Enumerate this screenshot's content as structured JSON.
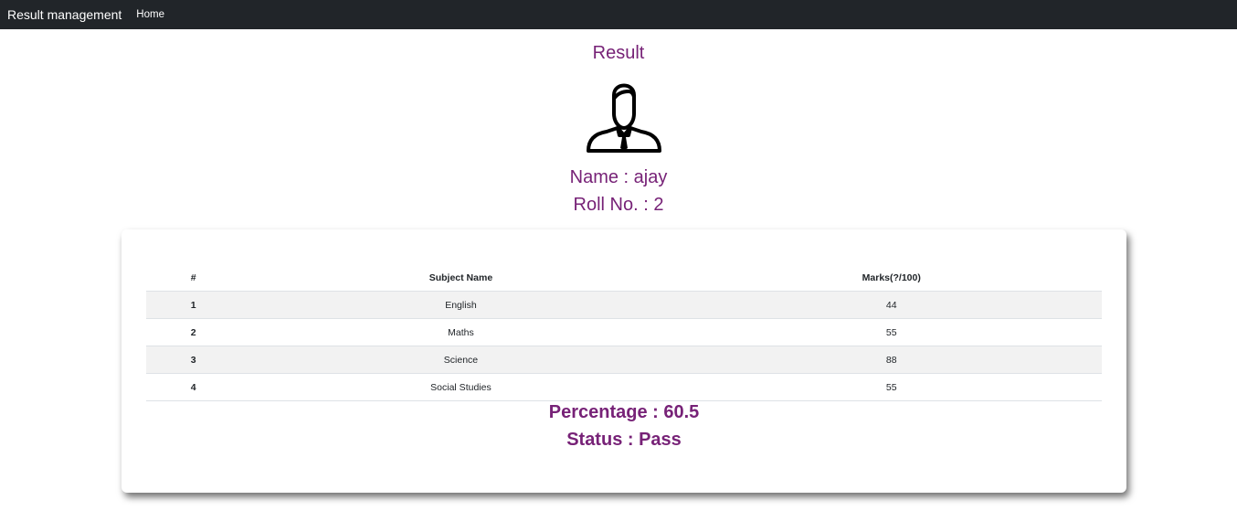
{
  "navbar": {
    "brand": "Result management",
    "links": [
      "Home"
    ]
  },
  "page": {
    "title": "Result",
    "avatar_icon": "user-avatar-icon",
    "name_line": "Name : ajay",
    "roll_line": "Roll No. : 2"
  },
  "table": {
    "headers": [
      "#",
      "Subject Name",
      "Marks(?/100)"
    ],
    "rows": [
      [
        "1",
        "English",
        "44"
      ],
      [
        "2",
        "Maths",
        "55"
      ],
      [
        "3",
        "Science",
        "88"
      ],
      [
        "4",
        "Social Studies",
        "55"
      ]
    ]
  },
  "summary": {
    "percentage": "Percentage : 60.5",
    "status": "Status : Pass"
  },
  "colors": {
    "navbar_bg": "#212529",
    "accent": "#772277",
    "stripe": "#f2f2f2"
  }
}
